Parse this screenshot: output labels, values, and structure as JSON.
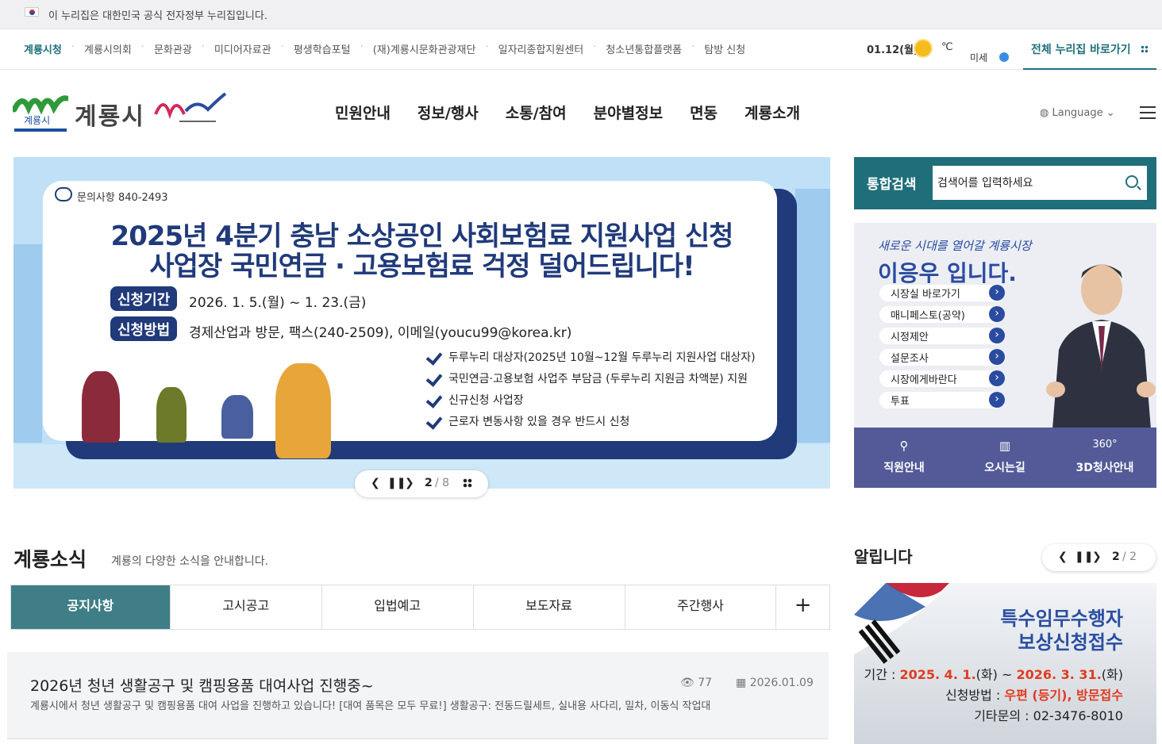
{
  "gov_banner": "이 누리집은 대한민국 공식 전자정부 누리집입니다.",
  "toplinks": [
    "계룡시청",
    "계룡시의회",
    "문화관광",
    "미디어자료관",
    "평생학습포털",
    "(재)계룡시문화관광재단",
    "일자리종합지원센터",
    "청소년통합플랫폼",
    "탐방 신청"
  ],
  "weather": {
    "date": "01.12(월)",
    "temp": "℃",
    "dust": "미세"
  },
  "all_sites": "전체 누리집 바로가기",
  "logo": {
    "name": "계룡시",
    "mark_text": "계룡시"
  },
  "gnb": [
    "민원안내",
    "정보/행사",
    "소통/참여",
    "분야별정보",
    "면동",
    "계룡소개"
  ],
  "language": "Language",
  "banner": {
    "inquiry": "문의사항 840-2493",
    "title1": "2025년 4분기 충남 소상공인 사회보험료 지원사업 신청",
    "title2": "사업장 국민연금 · 고용보험료 걱정 덜어드립니다!",
    "period_label": "신청기간",
    "period": "2026. 1. 5.(월) ~ 1. 23.(금)",
    "method_label": "신청방법",
    "method": "경제산업과 방문, 팩스(240-2509), 이메일(youcu99@korea.kr)",
    "checks": [
      "두루누리 대상자(2025년 10월~12월 두루누리 지원사업 대상자)",
      "국민연금·고용보험 사업주 부담금 (두루누리 지원금 차액분) 지원",
      "신규신청 사업장",
      "근로자 변동사항 있을 경우 반드시 신청"
    ],
    "page": "2",
    "total": "/ 8"
  },
  "search": {
    "label": "통합검색",
    "placeholder": "검색어를 입력하세요"
  },
  "mayor": {
    "handwriting": "새로운 시대를 열어갈 계룡시장",
    "name": "이응우 입니다.",
    "links": [
      "시장실 바로가기",
      "매니페스토(공약)",
      "시정제안",
      "설문조사",
      "시장에게바란다",
      "투표"
    ],
    "bar": [
      {
        "icon": "⚲",
        "label": "직원안내"
      },
      {
        "icon": "▥",
        "label": "오시는길"
      },
      {
        "icon": "360°",
        "label": "3D청사안내"
      }
    ]
  },
  "news": {
    "title": "계룡소식",
    "subtitle": "계룡의 다양한 소식을 안내합니다.",
    "tabs": [
      "공지사항",
      "고시공고",
      "입법예고",
      "보도자료",
      "주간행사"
    ],
    "plus": "+",
    "post": {
      "title": "2026년 청년 생활공구 및 캠핑용품 대여사업 진행중~",
      "views": "77",
      "date": "2026.01.09",
      "summary": "계룡시에서 청년 생활공구 및 캠핑용품 대여 사업을 진행하고 있습니다!     [대여 품목은 모두 무료!] 생활공구: 전동드릴세트, 실내용 사다리, 밀차, 이동식 작업대"
    }
  },
  "notice": {
    "title": "알립니다",
    "page": "2",
    "total": "/ 2",
    "banner_title1": "특수임무수행자",
    "banner_title2": "보상신청접수",
    "period_label": "기간 : ",
    "period_start": "2025. 4. 1.",
    "period_start_day": "(화) ~ ",
    "period_end": "2026. 3. 31.",
    "period_end_day": "(화)",
    "method_label": "신청방법 : ",
    "method": "우편 (등기), 방문접수",
    "contact": "기타문의 : 02-3476-8010"
  },
  "colors": {
    "teal": "#1f6f7a",
    "navy": "#203a7a",
    "mayor_bar": "#535a97"
  }
}
